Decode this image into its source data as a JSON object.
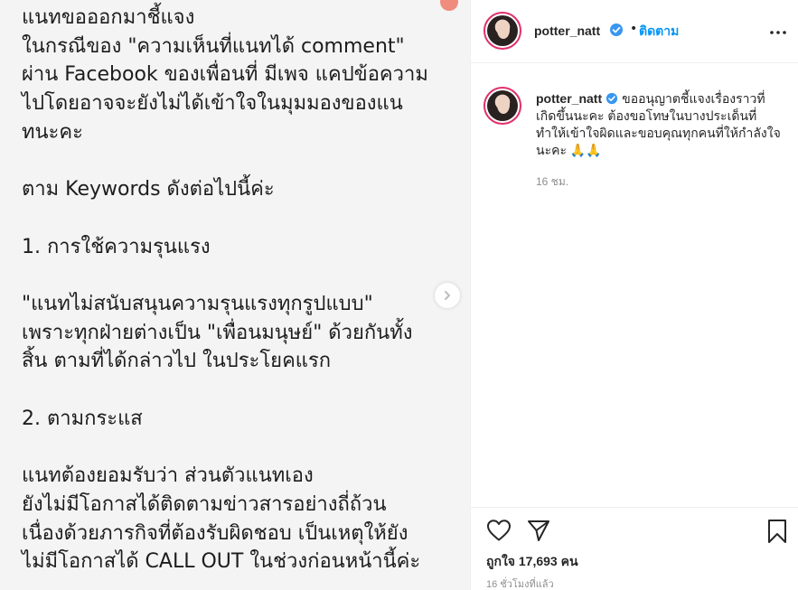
{
  "post": {
    "image_text": "แนทขอออกมาชี้แจง\nในกรณีของ \"ความเห็นที่แนทได้ comment\"\nผ่าน Facebook ของเพื่อนที่ มีเพจ แคปข้อความ\nไปโดยอาจจะยังไม่ได้เข้าใจในมุมมองของแน\nทนะคะ\n\nตาม Keywords ดังต่อไปนี้ค่ะ\n\n1. การใช้ความรุนแรง\n\n\"แนทไม่สนับสนุนความรุนแรงทุกรูปแบบ\"\nเพราะทุกฝ่ายต่างเป็น \"เพื่อนมนุษย์\" ด้วยกันทั้ง\nสิ้น ตามที่ได้กล่าวไป ในประโยคแรก\n\n2. ตามกระแส\n\nแนทต้องยอมรับว่า ส่วนตัวแนทเอง\nยังไม่มีโอกาสได้ติดตามข่าวสารอย่างถี่ถ้วน\nเนื่องด้วยภารกิจที่ต้องรับผิดชอบ เป็นเหตุให้ยัง\nไม่มีโอกาสได้ CALL OUT ในช่วงก่อนหน้านี้ค่ะ"
  },
  "header": {
    "username": "potter_natt",
    "separator": "•",
    "follow_label": "ติดตาม",
    "more_icon": "more-horizontal-icon"
  },
  "caption": {
    "username": "potter_natt",
    "text": "ขออนุญาตชี้แจงเรื่องราวที่เกิดขึ้นนะคะ ต้องขอโทษในบางประเด็นที่ทำให้เข้าใจผิดและขอบคุณทุกคนที่ให้กำลังใจนะคะ 🙏🙏",
    "time": "16 ชม."
  },
  "actions": {
    "like_icon": "heart-icon",
    "share_icon": "paper-plane-icon",
    "save_icon": "bookmark-icon",
    "likes_text": "ถูกใจ 17,693 คน",
    "posted_text": "16 ชั่วโมงที่แล้ว"
  },
  "colors": {
    "accent": "#0095f6",
    "verified": "#3897f0",
    "story_ring": "#e1306c",
    "muted": "#8e8e8e"
  }
}
